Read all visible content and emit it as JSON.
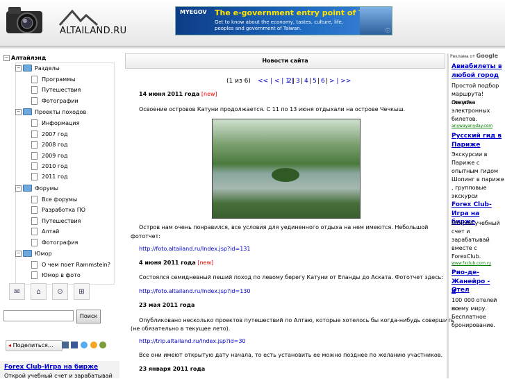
{
  "header": {
    "logo_text": "ALTAILAND.RU",
    "banner": {
      "brand": "MYEGOV",
      "headline": "The e-government entry point of Taiwan.",
      "sub": "Get to know about the economy, tastes, culture, life, peoples and government of Taiwan.",
      "info": "ⓘ"
    }
  },
  "tree": {
    "root": "Алтайлэнд",
    "items": [
      {
        "label": "Разделы"
      },
      {
        "label": "Программы"
      },
      {
        "label": "Путешествия"
      },
      {
        "label": "Фотографии"
      },
      {
        "label": "Проекты походов"
      },
      {
        "label": "Информация"
      },
      {
        "label": "2007 год"
      },
      {
        "label": "2008 год"
      },
      {
        "label": "2009 год"
      },
      {
        "label": "2010 год"
      },
      {
        "label": "2011 год"
      },
      {
        "label": "Форумы"
      },
      {
        "label": "Все форумы"
      },
      {
        "label": "Разработка ПО"
      },
      {
        "label": "Путешествия"
      },
      {
        "label": "Алтай"
      },
      {
        "label": "Фотография"
      },
      {
        "label": "Юмор"
      },
      {
        "label": "О чем поет Rammstein?"
      },
      {
        "label": "Юмор в фото"
      }
    ]
  },
  "search": {
    "button": "Поиск",
    "value": ""
  },
  "share": {
    "label": "Поделиться…"
  },
  "left_ad": {
    "title": "Forex Club-Игра на бирже",
    "desc": "Открой учебный счет и зарабатывай"
  },
  "main": {
    "title": "Новости сайта",
    "pager": {
      "count": "(1 из 6)",
      "nav": "<< | < | 1 |",
      "p2": "2",
      "p3": "3",
      "p4": "4",
      "p5": "5",
      "p6": "6",
      "next": "> | >>",
      "sep": "|"
    },
    "news": [
      {
        "date": "14 июня 2011 года",
        "flag": "[new]"
      },
      {
        "date": "4 июня 2011 года",
        "flag": "[new]"
      },
      {
        "date": "23 мая 2011 года"
      },
      {
        "date": "23 января 2011 года"
      }
    ],
    "t1": "Освоение островов Катуни продолжается. С 11 по 13 июня отдыхали на острове Чечкыш.",
    "t2a": "Остров нам очень понравился, все условия для уединенного отдыха на нем имеются. Небольшой",
    "t2b": "фототчет:",
    "link1": "http://foto.altailand.ru/Index.jsp?id=131",
    "t3": "Состоялся семидневный пеший поход по левому берегу Катуни от Еланды до Аската. Фототчет здесь:",
    "link2": "http://foto.altailand.ru/Index.jsp?id=130",
    "t4a": "Опубликовано несколько проектов путешествий по Алтаю, которые хотелось бы когда-нибудь совершить",
    "t4b": "(не обязательно в текущее лето).",
    "link3": "http://trip.altailand.ru/Index.jsp?id=30",
    "t5": "Все они имеют открытую дату начала, то есть установить ее можно позднее по желанию участников."
  },
  "right_ads": {
    "label": "Реклама от",
    "google": "Google",
    "ads": [
      {
        "t1": "Авиабилеты в",
        "t2": "любой город",
        "d": [
          "Простой подбор",
          "маршрута! Онлайн",
          "покупка",
          "электронных",
          "билетов."
        ],
        "u": "anywayanyday.com"
      },
      {
        "t1": "Русский гид в",
        "t2": "Париже",
        "d": [
          "Экскурсии в",
          "Париже с",
          "опытным гидом",
          "Шопинг в парижe",
          ", групповые",
          "экскурси"
        ]
      },
      {
        "t1": "Forex Club-",
        "t2": "Игра на бирже",
        "d": [
          "Открой учебный",
          "счет и",
          "зарабатывай",
          "вместе с",
          "ForexClub."
        ],
        "u": "www.fxclub.com.ru"
      },
      {
        "t1": "Рио-де-",
        "t2": "Жанейро - Отел",
        "t3": "и",
        "d": [
          "100 000 отелей по",
          "всему миру.",
          "Бесплатное",
          "бронирование."
        ]
      }
    ]
  }
}
